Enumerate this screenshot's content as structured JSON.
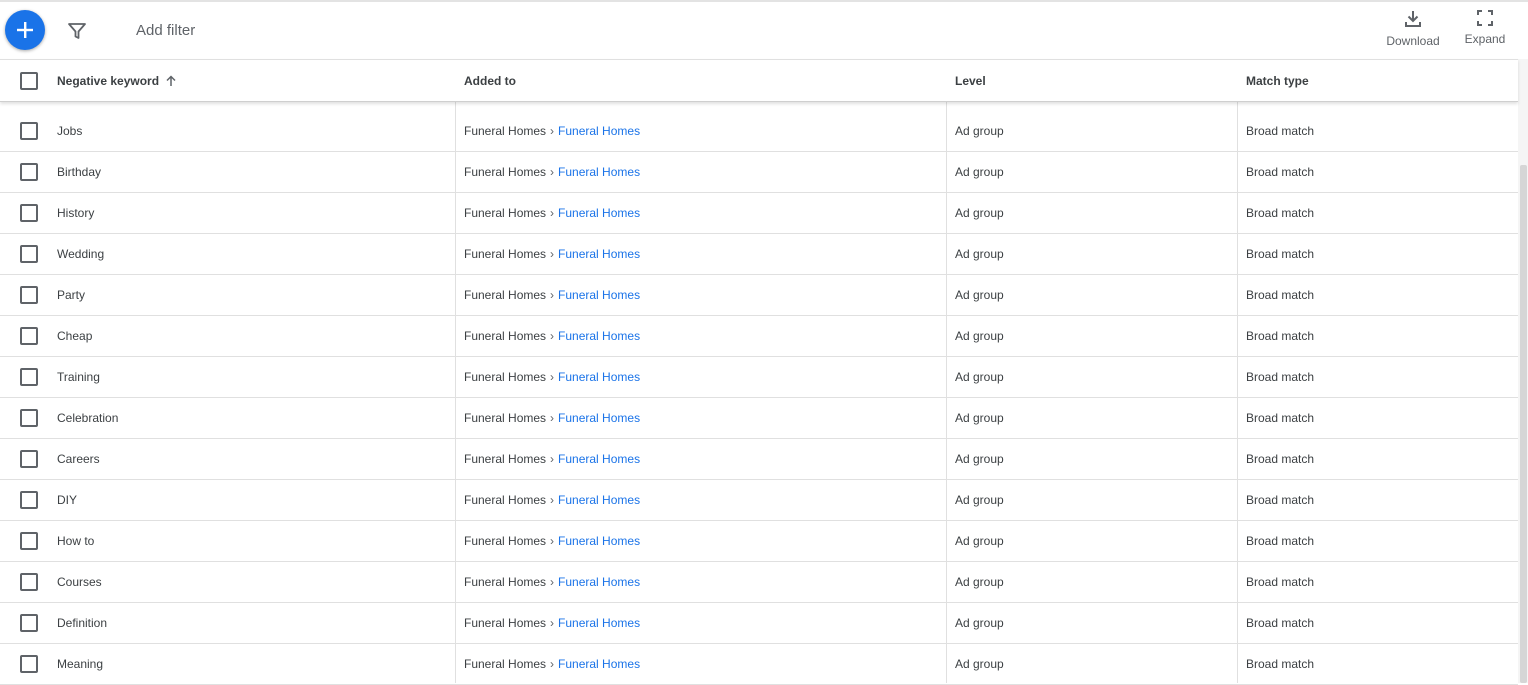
{
  "toolbar": {
    "add_filter_label": "Add filter",
    "download_label": "Download",
    "expand_label": "Expand"
  },
  "table": {
    "headers": {
      "keyword": "Negative keyword",
      "added_to": "Added to",
      "level": "Level",
      "match_type": "Match type"
    },
    "sort": {
      "column": "Negative keyword",
      "direction": "ascending"
    },
    "separator": "›",
    "rows": [
      {
        "keyword": "Jobs",
        "campaign": "Funeral Homes",
        "ad_group": "Funeral Homes",
        "level": "Ad group",
        "match_type": "Broad match"
      },
      {
        "keyword": "Birthday",
        "campaign": "Funeral Homes",
        "ad_group": "Funeral Homes",
        "level": "Ad group",
        "match_type": "Broad match"
      },
      {
        "keyword": "History",
        "campaign": "Funeral Homes",
        "ad_group": "Funeral Homes",
        "level": "Ad group",
        "match_type": "Broad match"
      },
      {
        "keyword": "Wedding",
        "campaign": "Funeral Homes",
        "ad_group": "Funeral Homes",
        "level": "Ad group",
        "match_type": "Broad match"
      },
      {
        "keyword": "Party",
        "campaign": "Funeral Homes",
        "ad_group": "Funeral Homes",
        "level": "Ad group",
        "match_type": "Broad match"
      },
      {
        "keyword": "Cheap",
        "campaign": "Funeral Homes",
        "ad_group": "Funeral Homes",
        "level": "Ad group",
        "match_type": "Broad match"
      },
      {
        "keyword": "Training",
        "campaign": "Funeral Homes",
        "ad_group": "Funeral Homes",
        "level": "Ad group",
        "match_type": "Broad match"
      },
      {
        "keyword": "Celebration",
        "campaign": "Funeral Homes",
        "ad_group": "Funeral Homes",
        "level": "Ad group",
        "match_type": "Broad match"
      },
      {
        "keyword": "Careers",
        "campaign": "Funeral Homes",
        "ad_group": "Funeral Homes",
        "level": "Ad group",
        "match_type": "Broad match"
      },
      {
        "keyword": "DIY",
        "campaign": "Funeral Homes",
        "ad_group": "Funeral Homes",
        "level": "Ad group",
        "match_type": "Broad match"
      },
      {
        "keyword": "How to",
        "campaign": "Funeral Homes",
        "ad_group": "Funeral Homes",
        "level": "Ad group",
        "match_type": "Broad match"
      },
      {
        "keyword": "Courses",
        "campaign": "Funeral Homes",
        "ad_group": "Funeral Homes",
        "level": "Ad group",
        "match_type": "Broad match"
      },
      {
        "keyword": "Definition",
        "campaign": "Funeral Homes",
        "ad_group": "Funeral Homes",
        "level": "Ad group",
        "match_type": "Broad match"
      },
      {
        "keyword": "Meaning",
        "campaign": "Funeral Homes",
        "ad_group": "Funeral Homes",
        "level": "Ad group",
        "match_type": "Broad match"
      }
    ]
  },
  "colors": {
    "accent": "#1a73e8",
    "link": "#1a73e8",
    "text": "#3c4043",
    "muted": "#5f6368",
    "divider": "#e0e0e0"
  },
  "icons": {
    "fab": "plus-icon",
    "filter": "filter-funnel-icon",
    "download": "download-icon",
    "expand": "fullscreen-expand-icon",
    "sort": "arrow-up-icon"
  }
}
